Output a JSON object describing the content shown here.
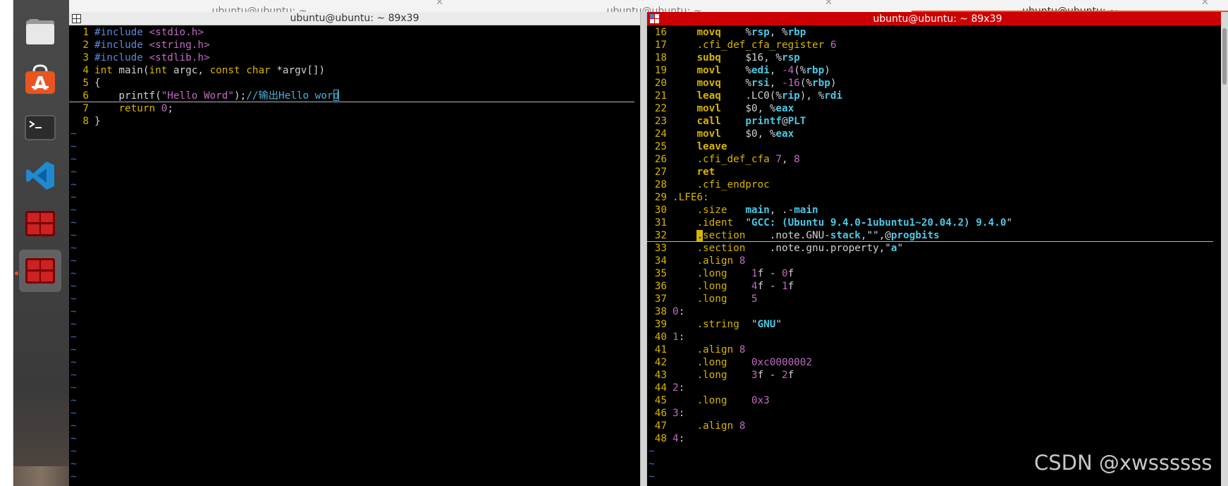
{
  "tabs": [
    {
      "label": "ubuntu@ubuntu: ~",
      "active": false
    },
    {
      "label": "ubuntu@ubuntu: ~",
      "active": false
    },
    {
      "label": "ubuntu@ubuntu: ~",
      "active": true
    }
  ],
  "accent_color": "#e95420",
  "active_title_color": "#cc0000",
  "dock": {
    "items": [
      {
        "name": "files-icon"
      },
      {
        "name": "software-center-icon"
      },
      {
        "name": "terminal-icon"
      },
      {
        "name": "vscode-icon"
      },
      {
        "name": "terminator-icon"
      },
      {
        "name": "terminator-icon-active"
      }
    ]
  },
  "left_terminal": {
    "title": "ubuntu@ubuntu: ~ 89x39",
    "lines": [
      {
        "n": "1",
        "text": "#include <stdio.h>"
      },
      {
        "n": "2",
        "text": "#include <string.h>"
      },
      {
        "n": "3",
        "text": "#include <stdlib.h>"
      },
      {
        "n": "4",
        "text": "int main(int argc, const char *argv[])"
      },
      {
        "n": "5",
        "text": "{"
      },
      {
        "n": "6",
        "text": "    printf(\"Hello Word\");//输出Hello word"
      },
      {
        "n": "7",
        "text": "    return 0;"
      },
      {
        "n": "8",
        "text": "}"
      }
    ],
    "cursor_line": "6",
    "empty_marker": "~"
  },
  "right_terminal": {
    "title": "ubuntu@ubuntu: ~ 89x39",
    "lines": [
      {
        "n": "16",
        "text": "    movq    %rsp, %rbp"
      },
      {
        "n": "17",
        "text": "    .cfi_def_cfa_register 6"
      },
      {
        "n": "18",
        "text": "    subq    $16, %rsp"
      },
      {
        "n": "19",
        "text": "    movl    %edi, -4(%rbp)"
      },
      {
        "n": "20",
        "text": "    movq    %rsi, -16(%rbp)"
      },
      {
        "n": "21",
        "text": "    leaq    .LC0(%rip), %rdi"
      },
      {
        "n": "22",
        "text": "    movl    $0, %eax"
      },
      {
        "n": "23",
        "text": "    call    printf@PLT"
      },
      {
        "n": "24",
        "text": "    movl    $0, %eax"
      },
      {
        "n": "25",
        "text": "    leave"
      },
      {
        "n": "26",
        "text": "    .cfi_def_cfa 7, 8"
      },
      {
        "n": "27",
        "text": "    ret"
      },
      {
        "n": "28",
        "text": "    .cfi_endproc"
      },
      {
        "n": "29",
        "text": ".LFE6:"
      },
      {
        "n": "30",
        "text": "    .size   main, .-main"
      },
      {
        "n": "31",
        "text": "    .ident  \"GCC: (Ubuntu 9.4.0-1ubuntu1~20.04.2) 9.4.0\""
      },
      {
        "n": "32",
        "text": "    .section    .note.GNU-stack,\"\",@progbits"
      },
      {
        "n": "33",
        "text": "    .section    .note.gnu.property,\"a\""
      },
      {
        "n": "34",
        "text": "    .align 8"
      },
      {
        "n": "35",
        "text": "    .long    1f - 0f"
      },
      {
        "n": "36",
        "text": "    .long    4f - 1f"
      },
      {
        "n": "37",
        "text": "    .long    5"
      },
      {
        "n": "38",
        "text": "0:"
      },
      {
        "n": "39",
        "text": "    .string  \"GNU\""
      },
      {
        "n": "40",
        "text": "1:"
      },
      {
        "n": "41",
        "text": "    .align 8"
      },
      {
        "n": "42",
        "text": "    .long    0xc0000002"
      },
      {
        "n": "43",
        "text": "    .long    3f - 2f"
      },
      {
        "n": "44",
        "text": "2:"
      },
      {
        "n": "45",
        "text": "    .long    0x3"
      },
      {
        "n": "46",
        "text": "3:"
      },
      {
        "n": "47",
        "text": "    .align 8"
      },
      {
        "n": "48",
        "text": "4:"
      }
    ],
    "cursor_line": "32",
    "empty_marker": "~"
  },
  "watermark": "CSDN @xwssssss"
}
